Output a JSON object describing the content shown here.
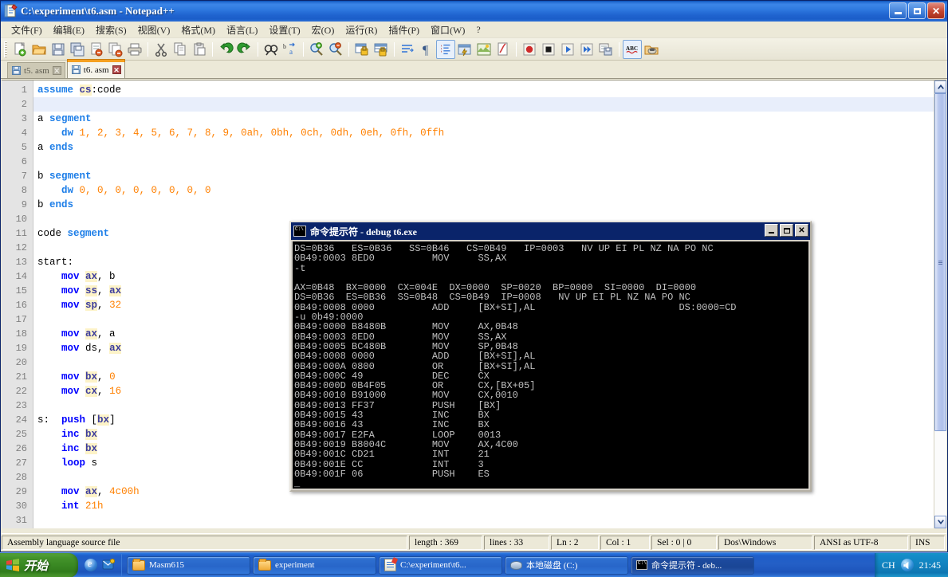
{
  "npp": {
    "title": "C:\\experiment\\t6.asm - Notepad++",
    "title_icon": "notepad-plus-plus-icon",
    "window_buttons": {
      "minimize": "_",
      "maximize": "□",
      "close": "✕"
    },
    "menu": [
      "文件(F)",
      "编辑(E)",
      "搜索(S)",
      "视图(V)",
      "格式(M)",
      "语言(L)",
      "设置(T)",
      "宏(O)",
      "运行(R)",
      "插件(P)",
      "窗口(W)",
      "?"
    ],
    "toolbar_icons": [
      "new-file-icon",
      "open-file-icon",
      "save-icon",
      "save-all-icon",
      "close-file-icon",
      "close-all-icon",
      "print-icon",
      "cut-icon",
      "copy-icon",
      "paste-icon",
      "undo-icon",
      "redo-icon",
      "find-icon",
      "replace-icon",
      "zoom-in-icon",
      "zoom-out-icon",
      "sync-vertical-icon",
      "sync-horizontal-icon",
      "word-wrap-icon",
      "show-all-chars-icon",
      "indent-guide-icon",
      "user-defined-dialog-icon",
      "show-doc-map-icon",
      "function-list-icon",
      "record-macro-icon",
      "stop-record-icon",
      "play-macro-icon",
      "run-macro-multiple-icon",
      "save-macro-icon",
      "spell-check-icon",
      "run-program-icon"
    ],
    "tabs": [
      {
        "label": "t5. asm",
        "active": false,
        "icon": "save-blue-icon",
        "close": "✕"
      },
      {
        "label": "t6. asm",
        "active": true,
        "icon": "save-blue-icon",
        "close": "✕"
      }
    ],
    "status": {
      "filetype": "Assembly language source file",
      "length": "length : 369",
      "lines": "lines : 33",
      "ln": "Ln : 2",
      "col": "Col : 1",
      "sel": "Sel : 0 | 0",
      "eol": "Dos\\Windows",
      "encoding": "ANSI as UTF-8",
      "insert": "INS"
    },
    "scrollbar": {
      "up": "▲",
      "down": "▼"
    }
  },
  "editor": {
    "current_line": 2,
    "line_numbers": [
      1,
      2,
      3,
      4,
      5,
      6,
      7,
      8,
      9,
      10,
      11,
      12,
      13,
      14,
      15,
      16,
      17,
      18,
      19,
      20,
      21,
      22,
      23,
      24,
      25,
      26,
      27,
      28,
      29,
      30,
      31
    ],
    "lines": [
      {
        "n": 1,
        "tokens": [
          {
            "t": "assume ",
            "c": "dir"
          },
          {
            "t": "cs",
            "c": "reg"
          },
          {
            "t": ":code",
            "c": "plain"
          }
        ]
      },
      {
        "n": 2,
        "tokens": []
      },
      {
        "n": 3,
        "tokens": [
          {
            "t": "a ",
            "c": "plain"
          },
          {
            "t": "segment",
            "c": "dir"
          }
        ]
      },
      {
        "n": 4,
        "tokens": [
          {
            "t": "    ",
            "c": "plain"
          },
          {
            "t": "dw ",
            "c": "dir"
          },
          {
            "t": "1, 2, 3, 4, 5, 6, 7, 8, 9, 0ah, 0bh, 0ch, 0dh, 0eh, 0fh, 0ffh",
            "c": "num"
          }
        ]
      },
      {
        "n": 5,
        "tokens": [
          {
            "t": "a ",
            "c": "plain"
          },
          {
            "t": "ends",
            "c": "dir"
          }
        ]
      },
      {
        "n": 6,
        "tokens": []
      },
      {
        "n": 7,
        "tokens": [
          {
            "t": "b ",
            "c": "plain"
          },
          {
            "t": "segment",
            "c": "dir"
          }
        ]
      },
      {
        "n": 8,
        "tokens": [
          {
            "t": "    ",
            "c": "plain"
          },
          {
            "t": "dw ",
            "c": "dir"
          },
          {
            "t": "0, 0, 0, 0, 0, 0, 0, 0",
            "c": "num"
          }
        ]
      },
      {
        "n": 9,
        "tokens": [
          {
            "t": "b ",
            "c": "plain"
          },
          {
            "t": "ends",
            "c": "dir"
          }
        ]
      },
      {
        "n": 10,
        "tokens": []
      },
      {
        "n": 11,
        "tokens": [
          {
            "t": "code ",
            "c": "plain"
          },
          {
            "t": "segment",
            "c": "dir"
          }
        ]
      },
      {
        "n": 12,
        "tokens": []
      },
      {
        "n": 13,
        "tokens": [
          {
            "t": "start:",
            "c": "plain"
          }
        ]
      },
      {
        "n": 14,
        "tokens": [
          {
            "t": "    ",
            "c": "plain"
          },
          {
            "t": "mov ",
            "c": "kw"
          },
          {
            "t": "ax",
            "c": "reg"
          },
          {
            "t": ", b",
            "c": "plain"
          }
        ]
      },
      {
        "n": 15,
        "tokens": [
          {
            "t": "    ",
            "c": "plain"
          },
          {
            "t": "mov ",
            "c": "kw"
          },
          {
            "t": "ss",
            "c": "reg"
          },
          {
            "t": ", ",
            "c": "plain"
          },
          {
            "t": "ax",
            "c": "reg"
          }
        ]
      },
      {
        "n": 16,
        "tokens": [
          {
            "t": "    ",
            "c": "plain"
          },
          {
            "t": "mov ",
            "c": "kw"
          },
          {
            "t": "sp",
            "c": "reg"
          },
          {
            "t": ", ",
            "c": "plain"
          },
          {
            "t": "32",
            "c": "num"
          }
        ]
      },
      {
        "n": 17,
        "tokens": []
      },
      {
        "n": 18,
        "tokens": [
          {
            "t": "    ",
            "c": "plain"
          },
          {
            "t": "mov ",
            "c": "kw"
          },
          {
            "t": "ax",
            "c": "reg"
          },
          {
            "t": ", a",
            "c": "plain"
          }
        ]
      },
      {
        "n": 19,
        "tokens": [
          {
            "t": "    ",
            "c": "plain"
          },
          {
            "t": "mov ",
            "c": "kw"
          },
          {
            "t": "ds",
            "c": "plain"
          },
          {
            "t": ", ",
            "c": "plain"
          },
          {
            "t": "ax",
            "c": "reg"
          }
        ]
      },
      {
        "n": 20,
        "tokens": []
      },
      {
        "n": 21,
        "tokens": [
          {
            "t": "    ",
            "c": "plain"
          },
          {
            "t": "mov ",
            "c": "kw"
          },
          {
            "t": "bx",
            "c": "reg"
          },
          {
            "t": ", ",
            "c": "plain"
          },
          {
            "t": "0",
            "c": "num"
          }
        ]
      },
      {
        "n": 22,
        "tokens": [
          {
            "t": "    ",
            "c": "plain"
          },
          {
            "t": "mov ",
            "c": "kw"
          },
          {
            "t": "cx",
            "c": "reg"
          },
          {
            "t": ", ",
            "c": "plain"
          },
          {
            "t": "16",
            "c": "num"
          }
        ]
      },
      {
        "n": 23,
        "tokens": []
      },
      {
        "n": 24,
        "tokens": [
          {
            "t": "s:  ",
            "c": "plain"
          },
          {
            "t": "push ",
            "c": "kw"
          },
          {
            "t": "[",
            "c": "plain"
          },
          {
            "t": "bx",
            "c": "reg"
          },
          {
            "t": "]",
            "c": "plain"
          }
        ]
      },
      {
        "n": 25,
        "tokens": [
          {
            "t": "    ",
            "c": "plain"
          },
          {
            "t": "inc ",
            "c": "kw"
          },
          {
            "t": "bx",
            "c": "reg"
          }
        ]
      },
      {
        "n": 26,
        "tokens": [
          {
            "t": "    ",
            "c": "plain"
          },
          {
            "t": "inc ",
            "c": "kw"
          },
          {
            "t": "bx",
            "c": "reg"
          }
        ]
      },
      {
        "n": 27,
        "tokens": [
          {
            "t": "    ",
            "c": "plain"
          },
          {
            "t": "loop ",
            "c": "kw"
          },
          {
            "t": "s",
            "c": "plain"
          }
        ]
      },
      {
        "n": 28,
        "tokens": []
      },
      {
        "n": 29,
        "tokens": [
          {
            "t": "    ",
            "c": "plain"
          },
          {
            "t": "mov ",
            "c": "kw"
          },
          {
            "t": "ax",
            "c": "reg"
          },
          {
            "t": ", ",
            "c": "plain"
          },
          {
            "t": "4c00h",
            "c": "num"
          }
        ]
      },
      {
        "n": 30,
        "tokens": [
          {
            "t": "    ",
            "c": "plain"
          },
          {
            "t": "int ",
            "c": "kw"
          },
          {
            "t": "21h",
            "c": "num"
          }
        ]
      },
      {
        "n": 31,
        "tokens": []
      }
    ]
  },
  "console": {
    "title": "命令提示符 - debug t6.exe",
    "title_icon": "command-prompt-icon",
    "buttons": {
      "minimize": "_",
      "maximize": "□",
      "close": "✕"
    },
    "lines": [
      "DS=0B36   ES=0B36   SS=0B46   CS=0B49   IP=0003   NV UP EI PL NZ NA PO NC",
      "0B49:0003 8ED0          MOV     SS,AX",
      "-t",
      "",
      "AX=0B48  BX=0000  CX=004E  DX=0000  SP=0020  BP=0000  SI=0000  DI=0000",
      "DS=0B36  ES=0B36  SS=0B48  CS=0B49  IP=0008   NV UP EI PL NZ NA PO NC",
      "0B49:0008 0000          ADD     [BX+SI],AL                         DS:0000=CD",
      "-u 0b49:0000",
      "0B49:0000 B8480B        MOV     AX,0B48",
      "0B49:0003 8ED0          MOV     SS,AX",
      "0B49:0005 BC480B        MOV     SP,0B48",
      "0B49:0008 0000          ADD     [BX+SI],AL",
      "0B49:000A 0800          OR      [BX+SI],AL",
      "0B49:000C 49            DEC     CX",
      "0B49:000D 0B4F05        OR      CX,[BX+05]",
      "0B49:0010 B91000        MOV     CX,0010",
      "0B49:0013 FF37          PUSH    [BX]",
      "0B49:0015 43            INC     BX",
      "0B49:0016 43            INC     BX",
      "0B49:0017 E2FA          LOOP    0013",
      "0B49:0019 B8004C        MOV     AX,4C00",
      "0B49:001C CD21          INT     21",
      "0B49:001E CC            INT     3",
      "0B49:001F 06            PUSH    ES",
      "_"
    ]
  },
  "taskbar": {
    "start_label": "开始",
    "start_icon": "windows-flag-icon",
    "quicklaunch": [
      "internet-explorer-icon",
      "outlook-express-icon"
    ],
    "tasks": [
      {
        "label": "Masm615",
        "icon": "folder-icon",
        "active": false
      },
      {
        "label": "experiment",
        "icon": "folder-icon",
        "active": false
      },
      {
        "label": "C:\\experiment\\t6...",
        "icon": "notepad-plus-plus-icon",
        "active": false
      },
      {
        "label": "本地磁盘 (C:)",
        "icon": "disk-icon",
        "active": false
      },
      {
        "label": "命令提示符 - deb...",
        "icon": "command-prompt-icon",
        "active": true
      }
    ],
    "tray": {
      "ime": "CH",
      "volume_icon": "speaker-icon",
      "clock": "21:45"
    }
  },
  "colors": {
    "title_blue": "#2f7ae0",
    "taskbar_blue": "#245fc6",
    "start_green": "#3b8a24",
    "console_bg": "#000000",
    "console_fg": "#c0c0c0",
    "keyword_blue": "#0000ff",
    "number_orange": "#ff8000",
    "register_highlight": "#fdf3c8"
  }
}
